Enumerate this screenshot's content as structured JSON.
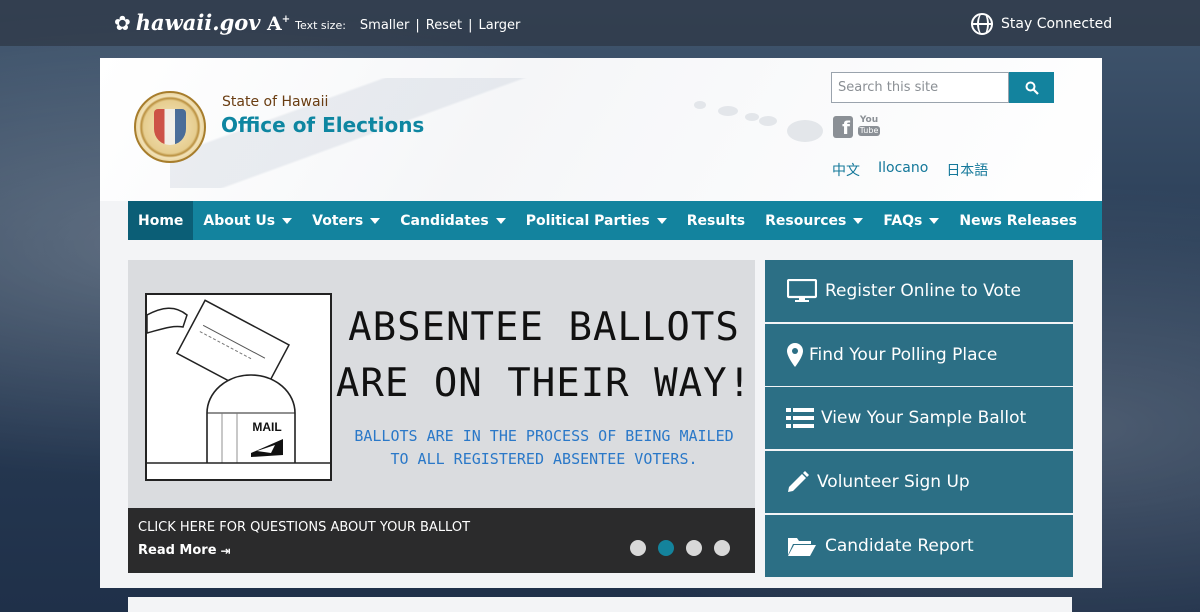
{
  "topbar": {
    "logo_text": "hawaii.gov",
    "text_size_label": "Text size:",
    "text_size_options": [
      "Smaller",
      "Reset",
      "Larger"
    ],
    "stay_connected": "Stay Connected"
  },
  "header": {
    "subtitle": "State of Hawaii",
    "title": "Office of Elections",
    "search_placeholder": "Search this site",
    "social": {
      "facebook": "f",
      "youtube_top": "You",
      "youtube_bottom": "Tube"
    },
    "languages": [
      "中文",
      "Ilocano",
      "日本語"
    ]
  },
  "nav": {
    "items": [
      {
        "label": "Home",
        "active": true,
        "dropdown": false
      },
      {
        "label": "About Us",
        "dropdown": true
      },
      {
        "label": "Voters",
        "dropdown": true
      },
      {
        "label": "Candidates",
        "dropdown": true
      },
      {
        "label": "Political Parties",
        "dropdown": true
      },
      {
        "label": "Results",
        "dropdown": false
      },
      {
        "label": "Resources",
        "dropdown": true
      },
      {
        "label": "FAQs",
        "dropdown": true
      },
      {
        "label": "News Releases",
        "dropdown": false
      }
    ]
  },
  "slider": {
    "headline_line1": "ABSENTEE BALLOTS",
    "headline_line2": "ARE ON THEIR WAY!",
    "subline_line1": "BALLOTS ARE IN THE PROCESS OF BEING MAILED",
    "subline_line2": "TO ALL REGISTERED ABSENTEE VOTERS.",
    "mail_label": "MAIL",
    "caption_title": "CLICK HERE FOR QUESTIONS ABOUT YOUR BALLOT",
    "read_more": "Read More",
    "dot_count": 4,
    "active_dot": 2
  },
  "quick_links": [
    {
      "label": "Register Online to Vote",
      "icon": "monitor-icon"
    },
    {
      "label": "Find Your Polling Place",
      "icon": "map-pin-icon"
    },
    {
      "label": "View Your Sample Ballot",
      "icon": "list-icon"
    },
    {
      "label": "Volunteer Sign Up",
      "icon": "pencil-icon"
    },
    {
      "label": "Candidate Report",
      "icon": "folder-open-icon"
    }
  ],
  "colors": {
    "accent": "#13839e",
    "nav_active": "#0b5e76",
    "quick_link_bg": "#2c6f85",
    "caption_bg": "#2b2b2c"
  }
}
